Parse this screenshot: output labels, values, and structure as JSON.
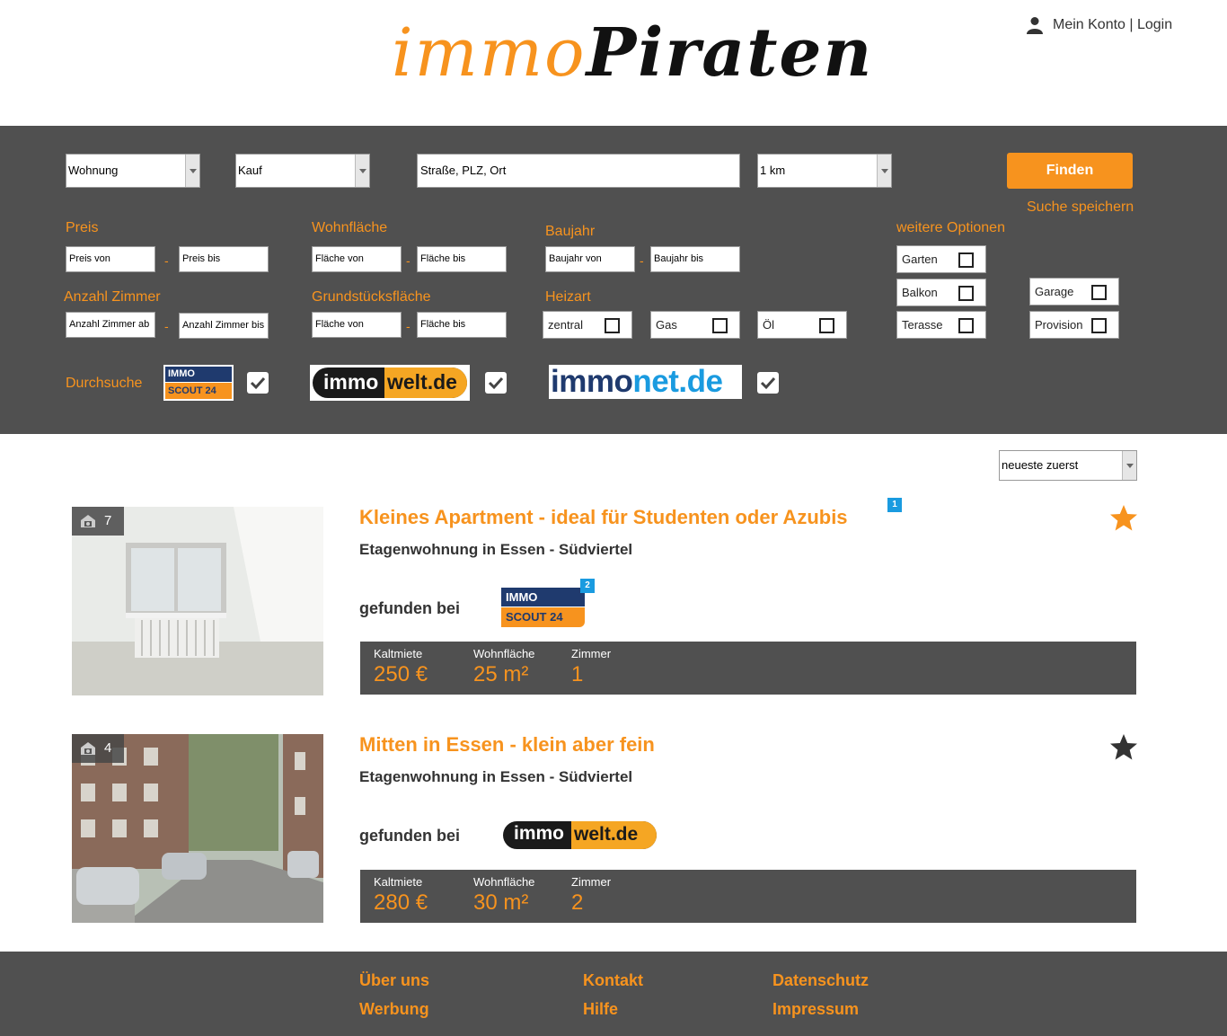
{
  "header": {
    "logo_part1": "immo",
    "logo_part2": "Piraten",
    "account_label": "Mein Konto | Login"
  },
  "search": {
    "type_value": "Wohnung",
    "mode_value": "Kauf",
    "location_placeholder": "Straße, PLZ, Ort",
    "radius_value": "1 km",
    "find_label": "Finden",
    "save_label": "Suche speichern",
    "price": {
      "label": "Preis",
      "from": "Preis von",
      "to": "Preis bis"
    },
    "area": {
      "label": "Wohnfläche",
      "from": "Fläche von",
      "to": "Fläche bis"
    },
    "year": {
      "label": "Baujahr",
      "from": "Baujahr von",
      "to": "Baujahr bis"
    },
    "rooms": {
      "label": "Anzahl Zimmer",
      "from": "Anzahl Zimmer ab",
      "to": "Anzahl Zimmer bis"
    },
    "plot": {
      "label": "Grundstücksfläche",
      "from": "Fläche von",
      "to": "Fläche bis"
    },
    "heating": {
      "label": "Heizart",
      "options": [
        "zentral",
        "Gas",
        "Öl"
      ]
    },
    "more": {
      "label": "weitere Optionen",
      "options": [
        "Garten",
        "Balkon",
        "Terasse",
        "Garage",
        "Provision"
      ]
    },
    "sources": {
      "label": "Durchsuche",
      "immoscout_top": "IMMO",
      "immoscout_bottom": "SCOUT 24",
      "immowelt_a": "immo",
      "immowelt_b": "welt.de",
      "immonet_a": "immo",
      "immonet_b": "net.de"
    }
  },
  "results": {
    "sort_value": "neueste zuerst",
    "items": [
      {
        "photo_count": "7",
        "title": "Kleines Apartment - ideal für Studenten oder Azubis",
        "title_badge": "1",
        "subtitle": "Etagenwohnung in Essen - Südviertel",
        "found_label": "gefunden bei",
        "source_badge": "2",
        "stat_labels": [
          "Kaltmiete",
          "Wohnfläche",
          "Zimmer"
        ],
        "stat_values": [
          "250 €",
          "25 m²",
          "1"
        ],
        "favorite_color": "#f7931e"
      },
      {
        "photo_count": "4",
        "title": "Mitten in Essen - klein aber fein",
        "subtitle": "Etagenwohnung in Essen - Südviertel",
        "found_label": "gefunden bei",
        "stat_labels": [
          "Kaltmiete",
          "Wohnfläche",
          "Zimmer"
        ],
        "stat_values": [
          "280 €",
          "30 m²",
          "2"
        ],
        "favorite_color": "#333333"
      }
    ]
  },
  "footer": {
    "links": [
      "Über uns",
      "Kontakt",
      "Datenschutz",
      "Werbung",
      "Hilfe",
      "Impressum"
    ]
  },
  "colors": {
    "accent": "#f7931e",
    "panel": "#505050",
    "badge": "#1a9be0"
  }
}
